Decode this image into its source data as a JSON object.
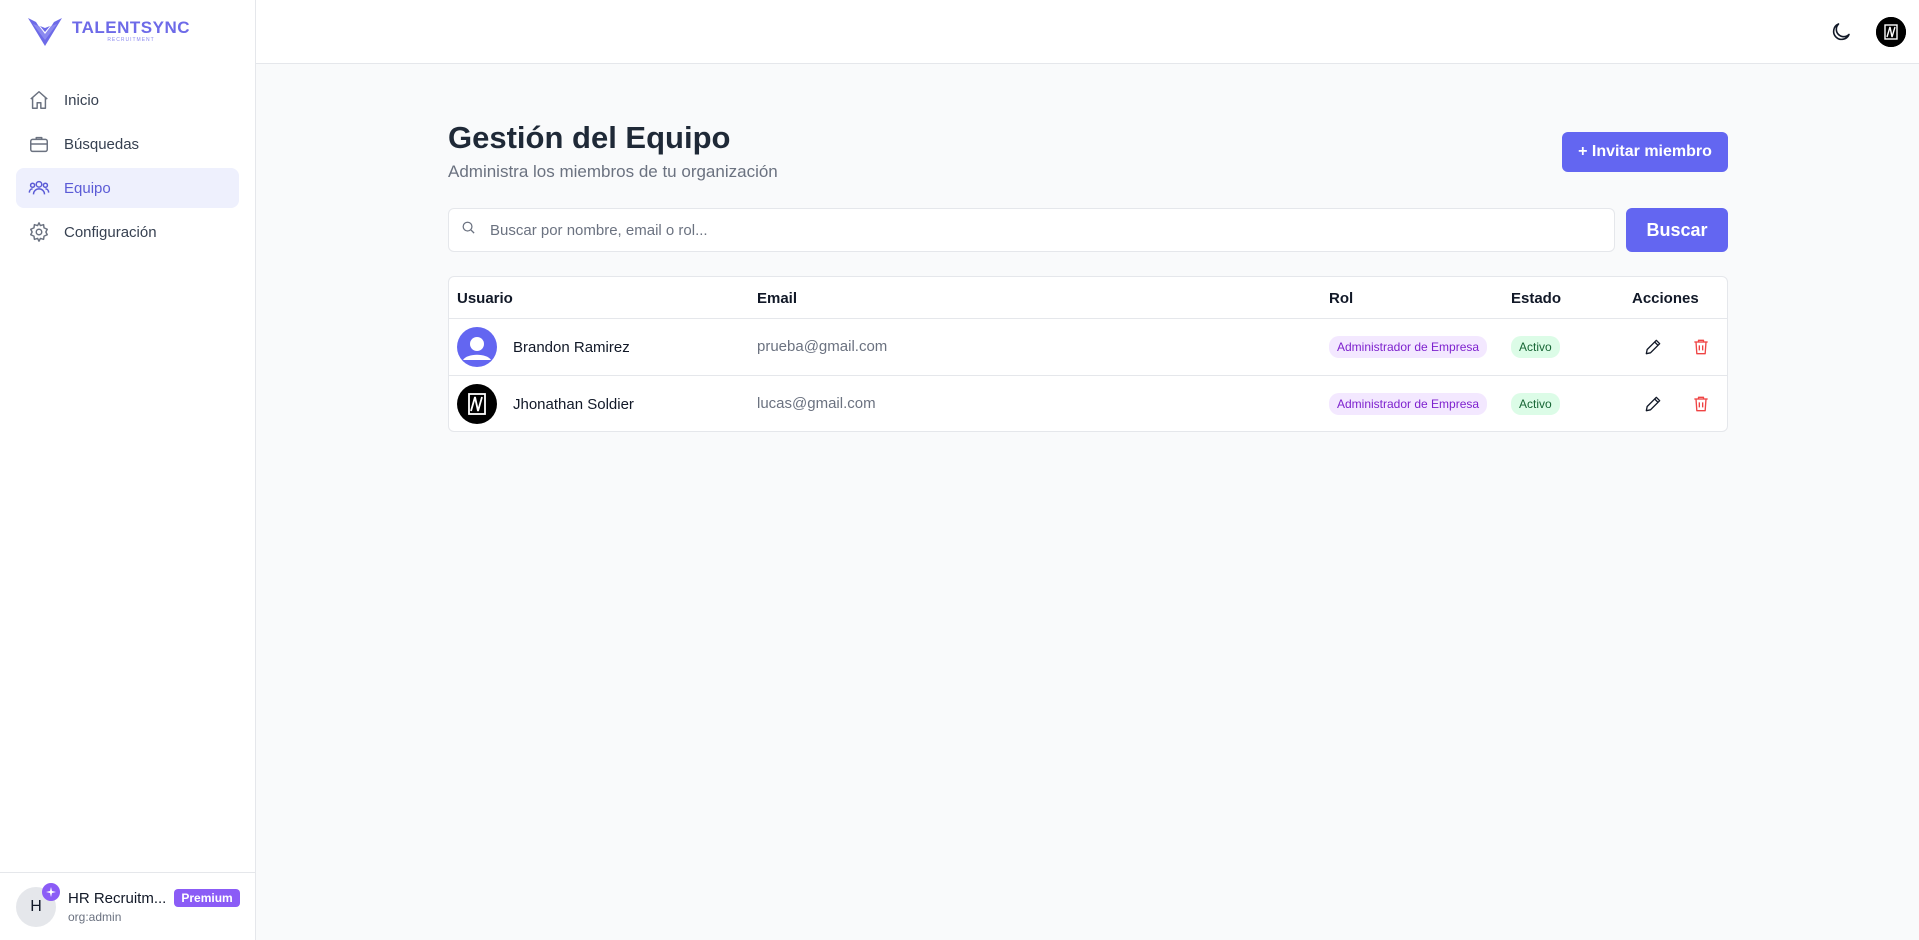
{
  "brand": {
    "name": "TALENTSYNC",
    "tagline": "RECRUITMENT",
    "color": "#6d6ae8"
  },
  "sidebar": {
    "items": [
      {
        "label": "Inicio",
        "icon": "home-icon",
        "active": false
      },
      {
        "label": "Búsquedas",
        "icon": "briefcase-icon",
        "active": false
      },
      {
        "label": "Equipo",
        "icon": "users-icon",
        "active": true
      },
      {
        "label": "Configuración",
        "icon": "gear-icon",
        "active": false
      }
    ],
    "footer": {
      "avatar_initial": "H",
      "org_name": "HR Recruitm...",
      "plan": "Premium",
      "role": "org:admin"
    }
  },
  "topbar": {
    "theme_icon": "moon-icon",
    "avatar_icon": "user-avatar-icon"
  },
  "main": {
    "title": "Gestión del Equipo",
    "subtitle": "Administra los miembros de tu organización",
    "invite_label": "+ Invitar miembro",
    "search": {
      "placeholder": "Buscar por nombre, email o rol...",
      "value": "",
      "button_label": "Buscar"
    },
    "table": {
      "headers": {
        "user": "Usuario",
        "email": "Email",
        "role": "Rol",
        "status": "Estado",
        "actions": "Acciones"
      },
      "rows": [
        {
          "name": "Brandon Ramirez",
          "email": "prueba@gmail.com",
          "role": "Administrador de Empresa",
          "status": "Activo",
          "avatar": "default-avatar-icon"
        },
        {
          "name": "Jhonathan Soldier",
          "email": "lucas@gmail.com",
          "role": "Administrador de Empresa",
          "status": "Activo",
          "avatar": "custom-avatar-icon"
        }
      ]
    }
  },
  "colors": {
    "accent": "#6366f1",
    "role_badge_bg": "#f3e8ff",
    "status_badge_bg": "#dcfce7",
    "delete": "#ef4444"
  }
}
